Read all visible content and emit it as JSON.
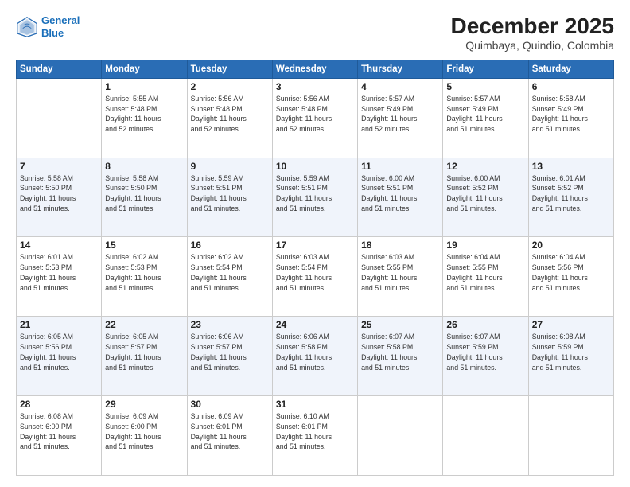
{
  "header": {
    "logo_line1": "General",
    "logo_line2": "Blue",
    "month": "December 2025",
    "location": "Quimbaya, Quindio, Colombia"
  },
  "days_of_week": [
    "Sunday",
    "Monday",
    "Tuesday",
    "Wednesday",
    "Thursday",
    "Friday",
    "Saturday"
  ],
  "weeks": [
    [
      {
        "day": "",
        "sunrise": "",
        "sunset": "",
        "daylight": ""
      },
      {
        "day": "1",
        "sunrise": "Sunrise: 5:55 AM",
        "sunset": "Sunset: 5:48 PM",
        "daylight": "Daylight: 11 hours and 52 minutes."
      },
      {
        "day": "2",
        "sunrise": "Sunrise: 5:56 AM",
        "sunset": "Sunset: 5:48 PM",
        "daylight": "Daylight: 11 hours and 52 minutes."
      },
      {
        "day": "3",
        "sunrise": "Sunrise: 5:56 AM",
        "sunset": "Sunset: 5:48 PM",
        "daylight": "Daylight: 11 hours and 52 minutes."
      },
      {
        "day": "4",
        "sunrise": "Sunrise: 5:57 AM",
        "sunset": "Sunset: 5:49 PM",
        "daylight": "Daylight: 11 hours and 52 minutes."
      },
      {
        "day": "5",
        "sunrise": "Sunrise: 5:57 AM",
        "sunset": "Sunset: 5:49 PM",
        "daylight": "Daylight: 11 hours and 51 minutes."
      },
      {
        "day": "6",
        "sunrise": "Sunrise: 5:58 AM",
        "sunset": "Sunset: 5:49 PM",
        "daylight": "Daylight: 11 hours and 51 minutes."
      }
    ],
    [
      {
        "day": "7",
        "sunrise": "Sunrise: 5:58 AM",
        "sunset": "Sunset: 5:50 PM",
        "daylight": "Daylight: 11 hours and 51 minutes."
      },
      {
        "day": "8",
        "sunrise": "Sunrise: 5:58 AM",
        "sunset": "Sunset: 5:50 PM",
        "daylight": "Daylight: 11 hours and 51 minutes."
      },
      {
        "day": "9",
        "sunrise": "Sunrise: 5:59 AM",
        "sunset": "Sunset: 5:51 PM",
        "daylight": "Daylight: 11 hours and 51 minutes."
      },
      {
        "day": "10",
        "sunrise": "Sunrise: 5:59 AM",
        "sunset": "Sunset: 5:51 PM",
        "daylight": "Daylight: 11 hours and 51 minutes."
      },
      {
        "day": "11",
        "sunrise": "Sunrise: 6:00 AM",
        "sunset": "Sunset: 5:51 PM",
        "daylight": "Daylight: 11 hours and 51 minutes."
      },
      {
        "day": "12",
        "sunrise": "Sunrise: 6:00 AM",
        "sunset": "Sunset: 5:52 PM",
        "daylight": "Daylight: 11 hours and 51 minutes."
      },
      {
        "day": "13",
        "sunrise": "Sunrise: 6:01 AM",
        "sunset": "Sunset: 5:52 PM",
        "daylight": "Daylight: 11 hours and 51 minutes."
      }
    ],
    [
      {
        "day": "14",
        "sunrise": "Sunrise: 6:01 AM",
        "sunset": "Sunset: 5:53 PM",
        "daylight": "Daylight: 11 hours and 51 minutes."
      },
      {
        "day": "15",
        "sunrise": "Sunrise: 6:02 AM",
        "sunset": "Sunset: 5:53 PM",
        "daylight": "Daylight: 11 hours and 51 minutes."
      },
      {
        "day": "16",
        "sunrise": "Sunrise: 6:02 AM",
        "sunset": "Sunset: 5:54 PM",
        "daylight": "Daylight: 11 hours and 51 minutes."
      },
      {
        "day": "17",
        "sunrise": "Sunrise: 6:03 AM",
        "sunset": "Sunset: 5:54 PM",
        "daylight": "Daylight: 11 hours and 51 minutes."
      },
      {
        "day": "18",
        "sunrise": "Sunrise: 6:03 AM",
        "sunset": "Sunset: 5:55 PM",
        "daylight": "Daylight: 11 hours and 51 minutes."
      },
      {
        "day": "19",
        "sunrise": "Sunrise: 6:04 AM",
        "sunset": "Sunset: 5:55 PM",
        "daylight": "Daylight: 11 hours and 51 minutes."
      },
      {
        "day": "20",
        "sunrise": "Sunrise: 6:04 AM",
        "sunset": "Sunset: 5:56 PM",
        "daylight": "Daylight: 11 hours and 51 minutes."
      }
    ],
    [
      {
        "day": "21",
        "sunrise": "Sunrise: 6:05 AM",
        "sunset": "Sunset: 5:56 PM",
        "daylight": "Daylight: 11 hours and 51 minutes."
      },
      {
        "day": "22",
        "sunrise": "Sunrise: 6:05 AM",
        "sunset": "Sunset: 5:57 PM",
        "daylight": "Daylight: 11 hours and 51 minutes."
      },
      {
        "day": "23",
        "sunrise": "Sunrise: 6:06 AM",
        "sunset": "Sunset: 5:57 PM",
        "daylight": "Daylight: 11 hours and 51 minutes."
      },
      {
        "day": "24",
        "sunrise": "Sunrise: 6:06 AM",
        "sunset": "Sunset: 5:58 PM",
        "daylight": "Daylight: 11 hours and 51 minutes."
      },
      {
        "day": "25",
        "sunrise": "Sunrise: 6:07 AM",
        "sunset": "Sunset: 5:58 PM",
        "daylight": "Daylight: 11 hours and 51 minutes."
      },
      {
        "day": "26",
        "sunrise": "Sunrise: 6:07 AM",
        "sunset": "Sunset: 5:59 PM",
        "daylight": "Daylight: 11 hours and 51 minutes."
      },
      {
        "day": "27",
        "sunrise": "Sunrise: 6:08 AM",
        "sunset": "Sunset: 5:59 PM",
        "daylight": "Daylight: 11 hours and 51 minutes."
      }
    ],
    [
      {
        "day": "28",
        "sunrise": "Sunrise: 6:08 AM",
        "sunset": "Sunset: 6:00 PM",
        "daylight": "Daylight: 11 hours and 51 minutes."
      },
      {
        "day": "29",
        "sunrise": "Sunrise: 6:09 AM",
        "sunset": "Sunset: 6:00 PM",
        "daylight": "Daylight: 11 hours and 51 minutes."
      },
      {
        "day": "30",
        "sunrise": "Sunrise: 6:09 AM",
        "sunset": "Sunset: 6:01 PM",
        "daylight": "Daylight: 11 hours and 51 minutes."
      },
      {
        "day": "31",
        "sunrise": "Sunrise: 6:10 AM",
        "sunset": "Sunset: 6:01 PM",
        "daylight": "Daylight: 11 hours and 51 minutes."
      },
      {
        "day": "",
        "sunrise": "",
        "sunset": "",
        "daylight": ""
      },
      {
        "day": "",
        "sunrise": "",
        "sunset": "",
        "daylight": ""
      },
      {
        "day": "",
        "sunrise": "",
        "sunset": "",
        "daylight": ""
      }
    ]
  ]
}
